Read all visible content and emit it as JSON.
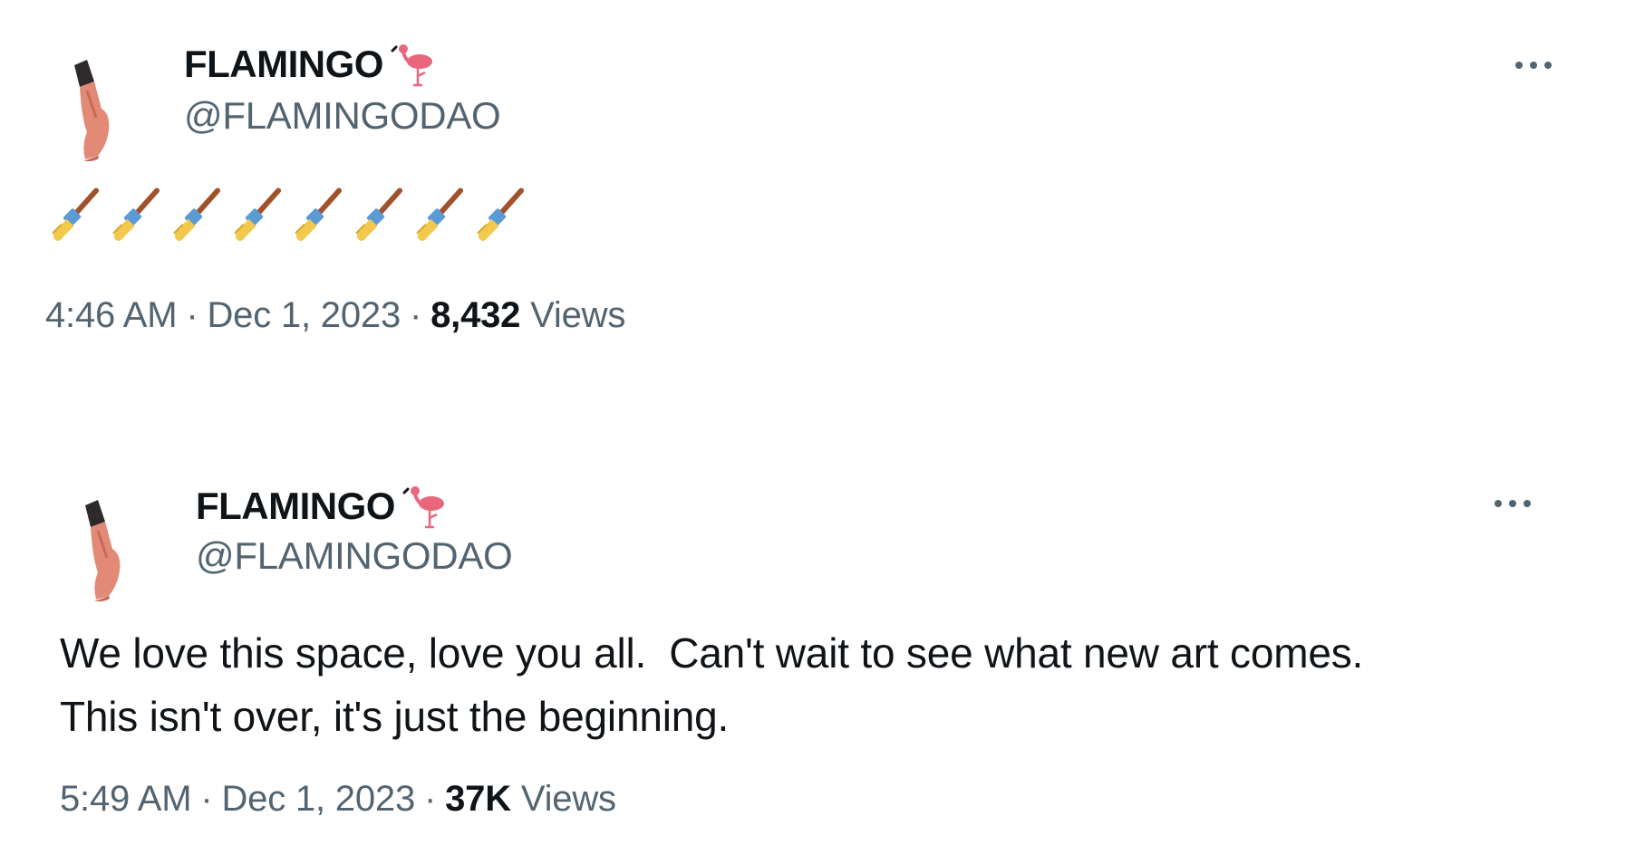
{
  "tweets": [
    {
      "display_name": "FLAMINGO",
      "name_icon": "flamingo-icon",
      "handle": "@FLAMINGODAO",
      "more_icon": "more-dots-icon",
      "content_icons": [
        "paintbrush-icon",
        "paintbrush-icon",
        "paintbrush-icon",
        "paintbrush-icon",
        "paintbrush-icon",
        "paintbrush-icon",
        "paintbrush-icon",
        "paintbrush-icon"
      ],
      "time": "4:46 AM",
      "separator": "·",
      "date": "Dec 1, 2023",
      "views_count": "8,432",
      "views_label": "Views"
    },
    {
      "display_name": "FLAMINGO",
      "name_icon": "flamingo-icon",
      "handle": "@FLAMINGODAO",
      "more_icon": "more-dots-icon",
      "text": "We love this space, love you all.  Can't wait to see what new art comes.\nThis isn't over, it's just the beginning.",
      "time": "5:49 AM",
      "separator": "·",
      "date": "Dec 1, 2023",
      "views_count": "37K",
      "views_label": "Views"
    }
  ],
  "colors": {
    "primary_text": "#0f1419",
    "secondary_text": "#536471",
    "flamingo_pink": "#e8677d",
    "avatar_salmon": "#e38a77"
  }
}
